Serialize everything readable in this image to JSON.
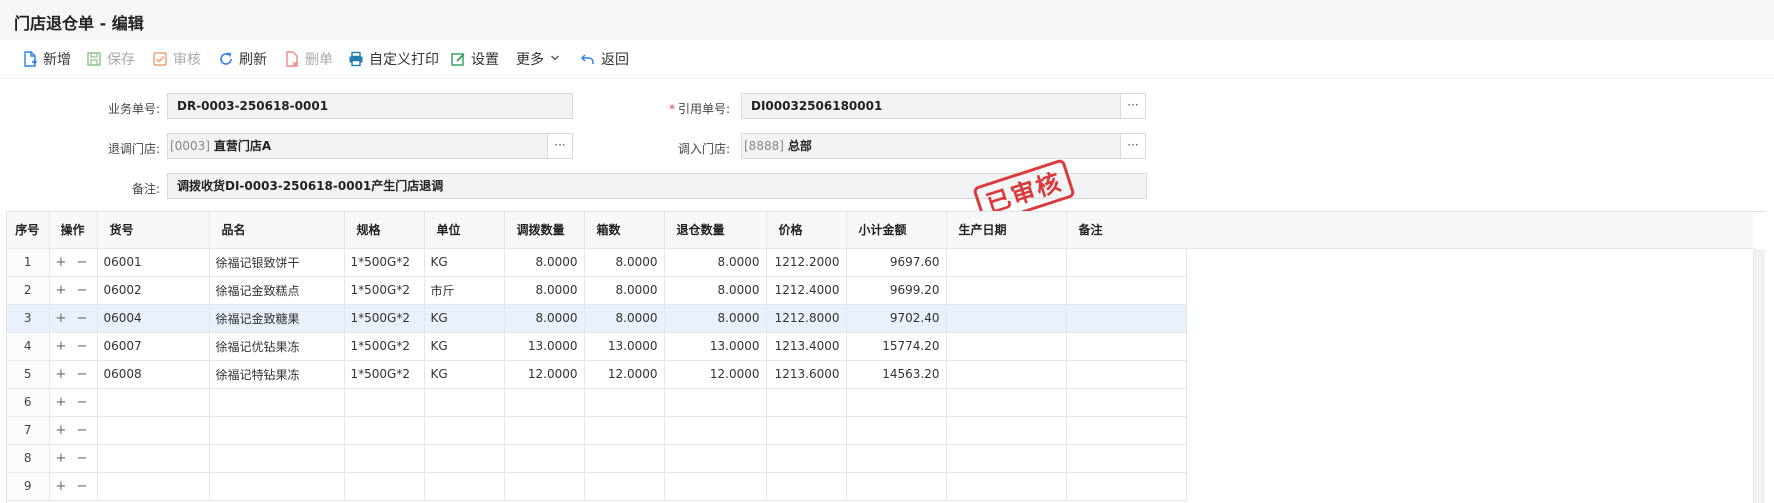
{
  "window": {
    "title": "门店退仓单 - 编辑"
  },
  "toolbar": {
    "new": "新增",
    "save": "保存",
    "audit": "审核",
    "refresh": "刷新",
    "delete": "删单",
    "custom_print": "自定义打印",
    "settings": "设置",
    "more": "更多",
    "back": "返回"
  },
  "form": {
    "biz_no_label": "业务单号:",
    "biz_no": "DR-0003-250618-0001",
    "ref_no_label": "引用单号:",
    "ref_no": "DI00032506180001",
    "out_store_label": "退调门店:",
    "out_store_code": "[0003]",
    "out_store_name": "直营门店A",
    "in_store_label": "调入门店:",
    "in_store_code": "[8888]",
    "in_store_name": "总部",
    "remark_label": "备注:",
    "remark": "调拨收货DI-0003-250618-0001产生门店退调",
    "picker": "···"
  },
  "stamp": "已审核",
  "table": {
    "headers": [
      "序号",
      "操作",
      "货号",
      "品名",
      "规格",
      "单位",
      "调拨数量",
      "箱数",
      "退仓数量",
      "价格",
      "小计金额",
      "生产日期",
      "备注"
    ],
    "ops": "+ −",
    "rows": [
      {
        "idx": "1",
        "code": "06001",
        "name": "徐福记银致饼干",
        "spec": "1*500G*2",
        "unit": "KG",
        "qty": "8.0000",
        "boxes": "8.0000",
        "ret": "8.0000",
        "price": "1212.2000",
        "amount": "9697.60",
        "date": "",
        "remark": ""
      },
      {
        "idx": "2",
        "code": "06002",
        "name": "徐福记金致糕点",
        "spec": "1*500G*2",
        "unit": "市斤",
        "qty": "8.0000",
        "boxes": "8.0000",
        "ret": "8.0000",
        "price": "1212.4000",
        "amount": "9699.20",
        "date": "",
        "remark": ""
      },
      {
        "idx": "3",
        "code": "06004",
        "name": "徐福记金致糖果",
        "spec": "1*500G*2",
        "unit": "KG",
        "qty": "8.0000",
        "boxes": "8.0000",
        "ret": "8.0000",
        "price": "1212.8000",
        "amount": "9702.40",
        "date": "",
        "remark": ""
      },
      {
        "idx": "4",
        "code": "06007",
        "name": "徐福记优钻果冻",
        "spec": "1*500G*2",
        "unit": "KG",
        "qty": "13.0000",
        "boxes": "13.0000",
        "ret": "13.0000",
        "price": "1213.4000",
        "amount": "15774.20",
        "date": "",
        "remark": ""
      },
      {
        "idx": "5",
        "code": "06008",
        "name": "徐福记特钻果冻",
        "spec": "1*500G*2",
        "unit": "KG",
        "qty": "12.0000",
        "boxes": "12.0000",
        "ret": "12.0000",
        "price": "1213.6000",
        "amount": "14563.20",
        "date": "",
        "remark": ""
      },
      {
        "idx": "6",
        "code": "",
        "name": "",
        "spec": "",
        "unit": "",
        "qty": "",
        "boxes": "",
        "ret": "",
        "price": "",
        "amount": "",
        "date": "",
        "remark": ""
      },
      {
        "idx": "7",
        "code": "",
        "name": "",
        "spec": "",
        "unit": "",
        "qty": "",
        "boxes": "",
        "ret": "",
        "price": "",
        "amount": "",
        "date": "",
        "remark": ""
      },
      {
        "idx": "8",
        "code": "",
        "name": "",
        "spec": "",
        "unit": "",
        "qty": "",
        "boxes": "",
        "ret": "",
        "price": "",
        "amount": "",
        "date": "",
        "remark": ""
      },
      {
        "idx": "9",
        "code": "",
        "name": "",
        "spec": "",
        "unit": "",
        "qty": "",
        "boxes": "",
        "ret": "",
        "price": "",
        "amount": "",
        "date": "",
        "remark": ""
      }
    ],
    "selected_row": 3
  },
  "colors": {
    "accent": "#2f80ed",
    "stamp": "#d92b2b",
    "selected_row": "#e8f1fc"
  },
  "icons": {
    "new": "new-doc-icon",
    "save": "save-icon",
    "audit": "audit-check-icon",
    "refresh": "refresh-icon",
    "delete": "delete-doc-icon",
    "custom_print": "print-icon",
    "settings": "settings-edit-icon",
    "more": "chevron-down-icon",
    "back": "back-arrow-icon"
  }
}
